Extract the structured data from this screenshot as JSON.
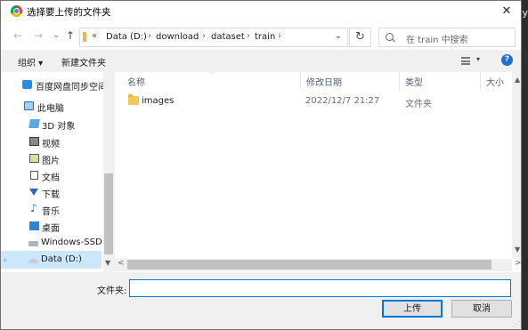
{
  "background": {
    "glyph": "y"
  },
  "window": {
    "title": "选择要上传的文件夹",
    "close": "✕"
  },
  "nav": {
    "back": "←",
    "forward": "→",
    "recent": "⌄",
    "up": "↑",
    "address": {
      "chevron": "«",
      "crumbs": [
        "Data (D:)",
        "download",
        "dataset",
        "train"
      ],
      "separator": "›",
      "dropdown": "⌄"
    },
    "refresh": "↻",
    "search_placeholder": "在 train 中搜索"
  },
  "toolbar": {
    "organize": "组织 ▾",
    "new_folder": "新建文件夹",
    "view_dropdown": "▾",
    "help": "?"
  },
  "sidebar": {
    "items": [
      {
        "label": "百度网盘同步空间",
        "icon": "cloud-icon"
      },
      {
        "label": "此电脑",
        "icon": "computer-icon"
      },
      {
        "label": "3D 对象",
        "icon": "3d-objects-icon"
      },
      {
        "label": "视频",
        "icon": "video-icon"
      },
      {
        "label": "图片",
        "icon": "pictures-icon"
      },
      {
        "label": "文档",
        "icon": "documents-icon"
      },
      {
        "label": "下载",
        "icon": "download-icon"
      },
      {
        "label": "音乐",
        "icon": "music-icon",
        "glyph": "♪"
      },
      {
        "label": "桌面",
        "icon": "desktop-icon"
      },
      {
        "label": "Windows-SSD (",
        "icon": "drive-icon"
      },
      {
        "label": "Data (D:)",
        "icon": "drive-icon",
        "selected": true
      }
    ],
    "expand": "›"
  },
  "columns": {
    "name": "名称",
    "modified": "修改日期",
    "type": "类型",
    "size": "大小",
    "sort_arrow": "^"
  },
  "files": [
    {
      "name": "images",
      "modified": "2022/12/7 21:27",
      "type": "文件夹"
    }
  ],
  "scroll": {
    "up": "▲",
    "down": "▼",
    "left": "<",
    "right": ">"
  },
  "footer": {
    "filename_label": "文件夹:",
    "filename_value": "",
    "upload": "上传",
    "cancel": "取消",
    "grip": "⋰"
  }
}
